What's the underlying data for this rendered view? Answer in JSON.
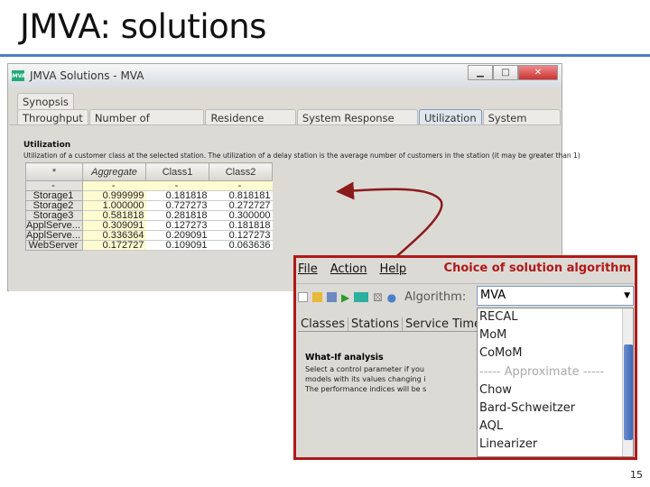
{
  "slide": {
    "title": "JMVA: solutions",
    "page": "15"
  },
  "window": {
    "title": "JMVA Solutions - MVA",
    "icon": "JMVA",
    "controls": [
      "minimize",
      "maximize",
      "close"
    ],
    "tabs_row1": [
      "Synopsis"
    ],
    "tabs_row2": [
      "Throughput",
      "Number of Customers",
      "Residence Times",
      "System Response Time",
      "Utilization",
      "System Power"
    ],
    "active_tab": "Utilization",
    "heading": "Utilization",
    "description": "Utilization of a customer class at the selected station. The utilization of a delay station is the average number of customers in the station (it may be greater than 1)",
    "table": {
      "headers": [
        "*",
        "Aggregate",
        "Class1",
        "Class2"
      ],
      "summary": [
        "-",
        "-",
        "-",
        "-"
      ],
      "rows": [
        [
          "Storage1",
          "0.999999",
          "0.181818",
          "0.818181"
        ],
        [
          "Storage2",
          "1.000000",
          "0.727273",
          "0.272727"
        ],
        [
          "Storage3",
          "0.581818",
          "0.281818",
          "0.300000"
        ],
        [
          "ApplServe...",
          "0.309091",
          "0.127273",
          "0.181818"
        ],
        [
          "ApplServe...",
          "0.336364",
          "0.209091",
          "0.127273"
        ],
        [
          "WebServer",
          "0.172727",
          "0.109091",
          "0.063636"
        ]
      ]
    }
  },
  "inset": {
    "caption": "Choice of solution algorithm",
    "accent": "#b01919",
    "menu": [
      "File",
      "Action",
      "Help"
    ],
    "algorithm_label": "Algorithm:",
    "algorithm_value": "MVA",
    "options": [
      "RECAL",
      "MoM",
      "CoMoM",
      "----- Approximate -----",
      "Chow",
      "Bard-Schweitzer",
      "AQL",
      "Linearizer"
    ],
    "tabs": [
      "Classes",
      "Stations",
      "Service Times"
    ],
    "whatif_title": "What-If analysis",
    "whatif_text": [
      "Select a control parameter if you",
      "models with its values changing i",
      "The performance indices will be s"
    ]
  }
}
